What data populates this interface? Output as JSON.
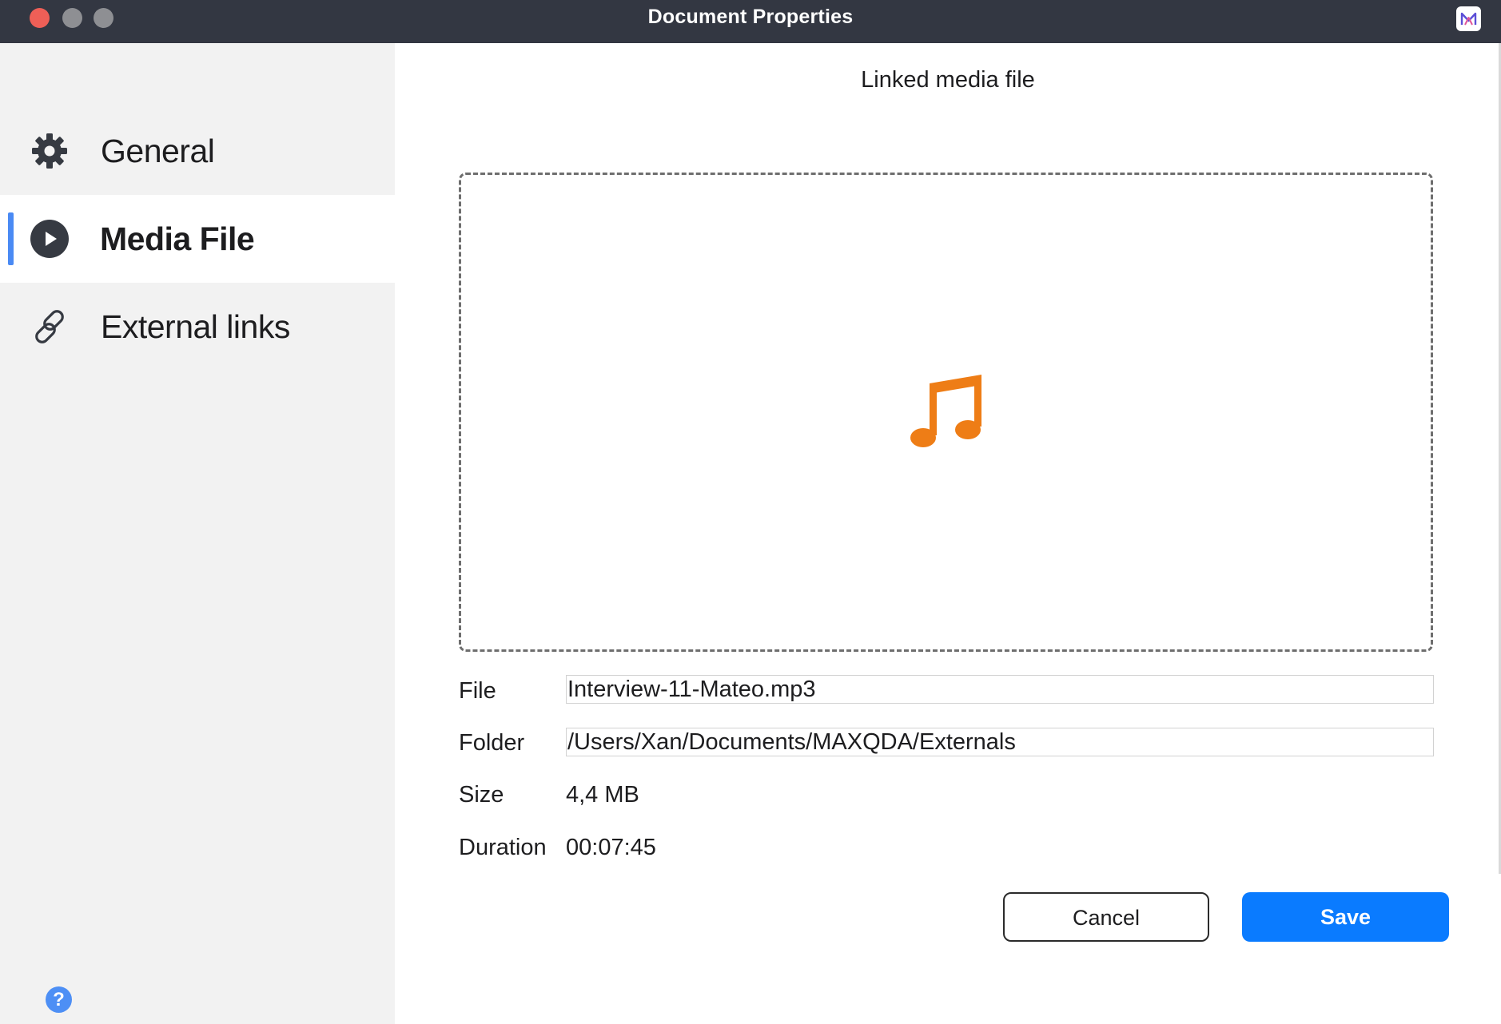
{
  "window": {
    "title": "Document Properties",
    "app_icon": "maxqda-logo-icon"
  },
  "sidebar": {
    "items": [
      {
        "label": "General",
        "icon": "gear-icon",
        "active": false
      },
      {
        "label": "Media File",
        "icon": "play-circle-icon",
        "active": true
      },
      {
        "label": "External links",
        "icon": "link-icon",
        "active": false
      }
    ],
    "help_icon": "question-circle-icon"
  },
  "main": {
    "heading": "Linked media file",
    "preview_icon": "music-note-icon",
    "fields": {
      "file_label": "File",
      "file_value": "Interview-11-Mateo.mp3",
      "folder_label": "Folder",
      "folder_value": "/Users/Xan/Documents/MAXQDA/Externals",
      "size_label": "Size",
      "size_value": "4,4 MB",
      "duration_label": "Duration",
      "duration_value": "00:07:45"
    },
    "buttons": {
      "cancel": "Cancel",
      "save": "Save"
    }
  },
  "colors": {
    "accent": "#0a7bff",
    "active_indicator": "#4a8af4",
    "media_icon": "#ee7d16",
    "titlebar": "#333742",
    "sidebar_bg": "#f2f2f2"
  }
}
